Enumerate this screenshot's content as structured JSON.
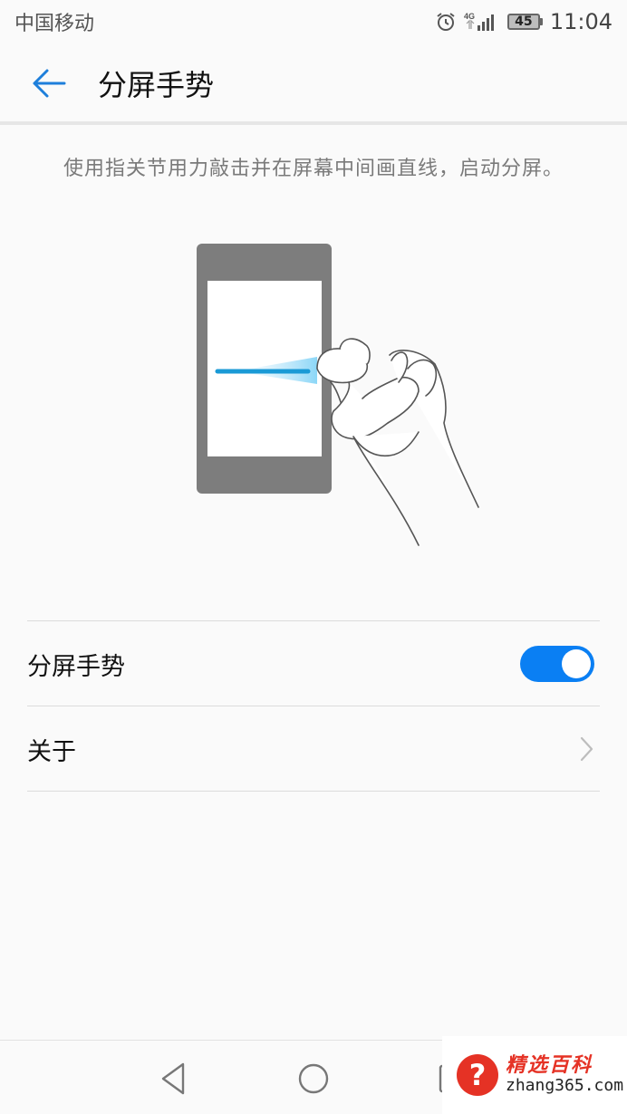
{
  "status_bar": {
    "carrier": "中国移动",
    "network_type": "4G",
    "battery_level": "45",
    "time": "11:04",
    "icons": [
      "alarm-icon",
      "signal-icon",
      "battery-icon"
    ]
  },
  "app_bar": {
    "back_icon": "back-arrow-icon",
    "title": "分屏手势"
  },
  "description": "使用指关节用力敲击并在屏幕中间画直线，启动分屏。",
  "settings": {
    "gesture_toggle": {
      "label": "分屏手势",
      "enabled": true
    },
    "about": {
      "label": "关于",
      "icon": "chevron-right-icon"
    }
  },
  "nav_bar": {
    "buttons": [
      "back-triangle-icon",
      "home-circle-icon",
      "recents-square-icon"
    ]
  },
  "watermark": {
    "badge": "?",
    "brand": "精选百科",
    "url": "zhang365.com"
  },
  "colors": {
    "accent": "#0a7ff3",
    "background": "#fafafa",
    "watermark_red": "#e53225"
  }
}
